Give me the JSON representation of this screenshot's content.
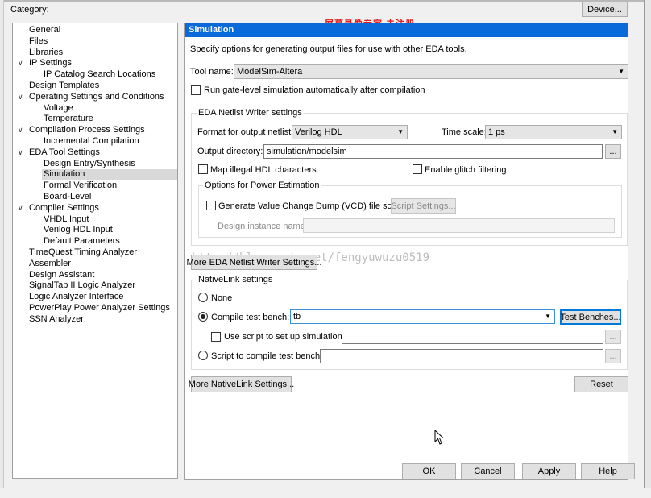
{
  "category_label": "Category:",
  "device_button": "Device...",
  "watermark_red": "屏幕录像专家 未注册",
  "watermark_url": "http://blog.csdn.net/fengyuwuzu0519",
  "tree": [
    {
      "label": "General",
      "level": 0,
      "expander": false,
      "selected": false
    },
    {
      "label": "Files",
      "level": 0,
      "expander": false,
      "selected": false
    },
    {
      "label": "Libraries",
      "level": 0,
      "expander": false,
      "selected": false
    },
    {
      "label": "IP Settings",
      "level": 0,
      "expander": true,
      "selected": false
    },
    {
      "label": "IP Catalog Search Locations",
      "level": 1,
      "expander": false,
      "selected": false
    },
    {
      "label": "Design Templates",
      "level": 0,
      "expander": false,
      "selected": false
    },
    {
      "label": "Operating Settings and Conditions",
      "level": 0,
      "expander": true,
      "selected": false
    },
    {
      "label": "Voltage",
      "level": 1,
      "expander": false,
      "selected": false
    },
    {
      "label": "Temperature",
      "level": 1,
      "expander": false,
      "selected": false
    },
    {
      "label": "Compilation Process Settings",
      "level": 0,
      "expander": true,
      "selected": false
    },
    {
      "label": "Incremental Compilation",
      "level": 1,
      "expander": false,
      "selected": false
    },
    {
      "label": "EDA Tool Settings",
      "level": 0,
      "expander": true,
      "selected": false
    },
    {
      "label": "Design Entry/Synthesis",
      "level": 1,
      "expander": false,
      "selected": false
    },
    {
      "label": "Simulation",
      "level": 1,
      "expander": false,
      "selected": true
    },
    {
      "label": "Formal Verification",
      "level": 1,
      "expander": false,
      "selected": false
    },
    {
      "label": "Board-Level",
      "level": 1,
      "expander": false,
      "selected": false
    },
    {
      "label": "Compiler Settings",
      "level": 0,
      "expander": true,
      "selected": false
    },
    {
      "label": "VHDL Input",
      "level": 1,
      "expander": false,
      "selected": false
    },
    {
      "label": "Verilog HDL Input",
      "level": 1,
      "expander": false,
      "selected": false
    },
    {
      "label": "Default Parameters",
      "level": 1,
      "expander": false,
      "selected": false
    },
    {
      "label": "TimeQuest Timing Analyzer",
      "level": 0,
      "expander": false,
      "selected": false
    },
    {
      "label": "Assembler",
      "level": 0,
      "expander": false,
      "selected": false
    },
    {
      "label": "Design Assistant",
      "level": 0,
      "expander": false,
      "selected": false
    },
    {
      "label": "SignalTap II Logic Analyzer",
      "level": 0,
      "expander": false,
      "selected": false
    },
    {
      "label": "Logic Analyzer Interface",
      "level": 0,
      "expander": false,
      "selected": false
    },
    {
      "label": "PowerPlay Power Analyzer Settings",
      "level": 0,
      "expander": false,
      "selected": false
    },
    {
      "label": "SSN Analyzer",
      "level": 0,
      "expander": false,
      "selected": false
    }
  ],
  "panel": {
    "title": "Simulation",
    "description": "Specify options for generating output files for use with other EDA tools.",
    "tool_name_label": "Tool name:",
    "tool_name_value": "ModelSim-Altera",
    "run_gate_level_label": "Run gate-level simulation automatically after compilation",
    "run_gate_level_checked": false,
    "netlist_group_title": "EDA Netlist Writer settings",
    "format_label": "Format for output netlist:",
    "format_value": "Verilog HDL",
    "time_scale_label": "Time scale:",
    "time_scale_value": "1 ps",
    "output_dir_label": "Output directory:",
    "output_dir_value": "simulation/modelsim",
    "browse_label": "...",
    "map_illegal_label": "Map illegal HDL characters",
    "map_illegal_checked": false,
    "glitch_label": "Enable glitch filtering",
    "glitch_checked": false,
    "power_group_title": "Options for Power Estimation",
    "vcd_label": "Generate Value Change Dump (VCD) file script",
    "vcd_checked": false,
    "script_settings_label": "Script Settings...",
    "design_instance_label": "Design instance name:",
    "design_instance_value": "",
    "more_netlist_button": "More EDA Netlist Writer Settings...",
    "nativelink_group_title": "NativeLink settings",
    "none_label": "None",
    "compile_tb_label": "Compile test bench:",
    "compile_tb_value": "tb",
    "test_benches_button": "Test Benches...",
    "use_script_label": "Use script to set up simulation:",
    "use_script_checked": false,
    "use_script_value": "",
    "script_compile_label": "Script to compile test bench:",
    "script_compile_value": "",
    "more_nativelink_button": "More NativeLink Settings...",
    "reset_button": "Reset",
    "selected_radio": "compile_tb"
  },
  "footer": {
    "ok": "OK",
    "cancel": "Cancel",
    "apply": "Apply",
    "help": "Help"
  }
}
